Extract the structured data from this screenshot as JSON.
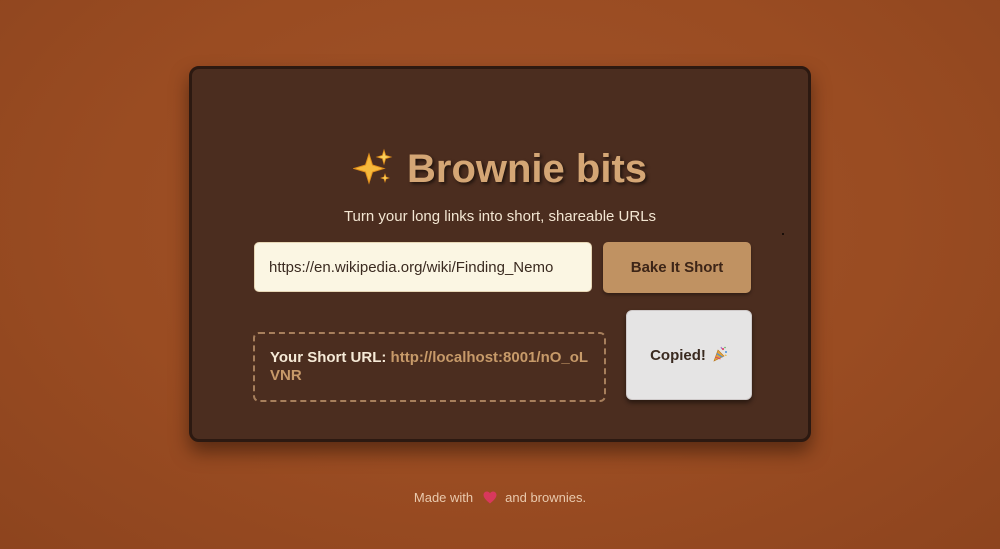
{
  "app": {
    "title": "Brownie bits",
    "subtitle": "Turn your long links into short, shareable URLs",
    "title_icon": "sparkles-icon"
  },
  "form": {
    "url_value": "https://en.wikipedia.org/wiki/Finding_Nemo",
    "submit_label": "Bake It Short"
  },
  "result": {
    "label": "Your Short URL:",
    "short_url": "http://localhost:8001/nO_oLVNR",
    "copy_label": "Copied!",
    "copy_icon": "party-popper-icon"
  },
  "footer": {
    "prefix": "Made with",
    "icon": "heart-icon",
    "suffix": "and brownies."
  },
  "colors": {
    "background": "#9a4c22",
    "card": "#4b2d1f",
    "accent": "#c09262",
    "title": "#d4a675",
    "link": "#c79a69"
  }
}
